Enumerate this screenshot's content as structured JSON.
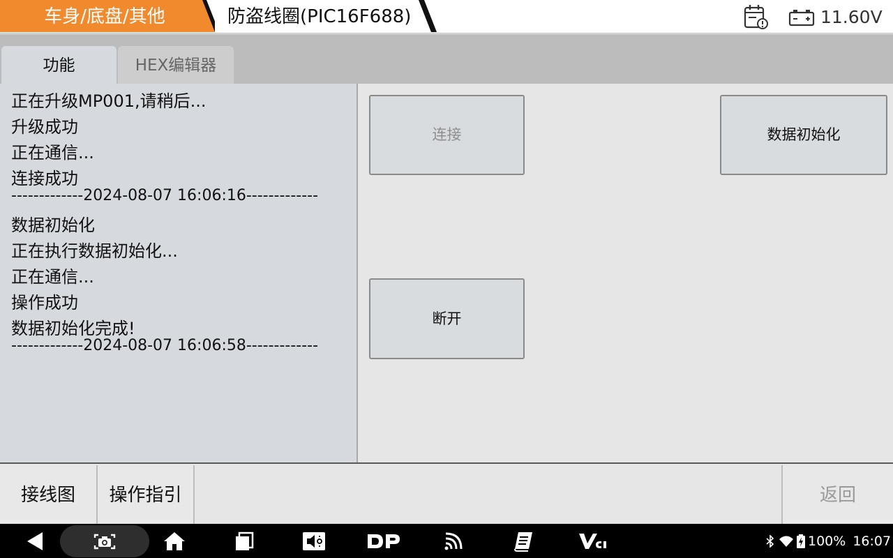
{
  "header": {
    "breadcrumb_category": "车身/底盘/其他",
    "breadcrumb_module": "防盗线圈(PIC16F688)",
    "voltage": "11.60V",
    "accent_color": "#f08a2c"
  },
  "tabs": [
    {
      "label": "功能",
      "active": true
    },
    {
      "label": "HEX编辑器",
      "active": false
    }
  ],
  "log": [
    "正在升级MP001,请稍后...",
    "升级成功",
    "正在通信...",
    "连接成功",
    "-------------2024-08-07 16:06:16-------------",
    "数据初始化",
    "正在执行数据初始化...",
    "正在通信...",
    "操作成功",
    "数据初始化完成!",
    "-------------2024-08-07 16:06:58-------------"
  ],
  "functions": {
    "connect": "连接",
    "data_init": "数据初始化",
    "disconnect": "断开"
  },
  "toolbar": {
    "wiring": "接线图",
    "guide": "操作指引",
    "back": "返回"
  },
  "status": {
    "battery": "100%",
    "time": "16:07"
  },
  "nav_icons": [
    "back-icon",
    "screenshot-icon",
    "home-icon",
    "recents-icon",
    "volume-icon",
    "dp-icon",
    "vci-signal-icon",
    "manual-icon",
    "vci-icon"
  ]
}
